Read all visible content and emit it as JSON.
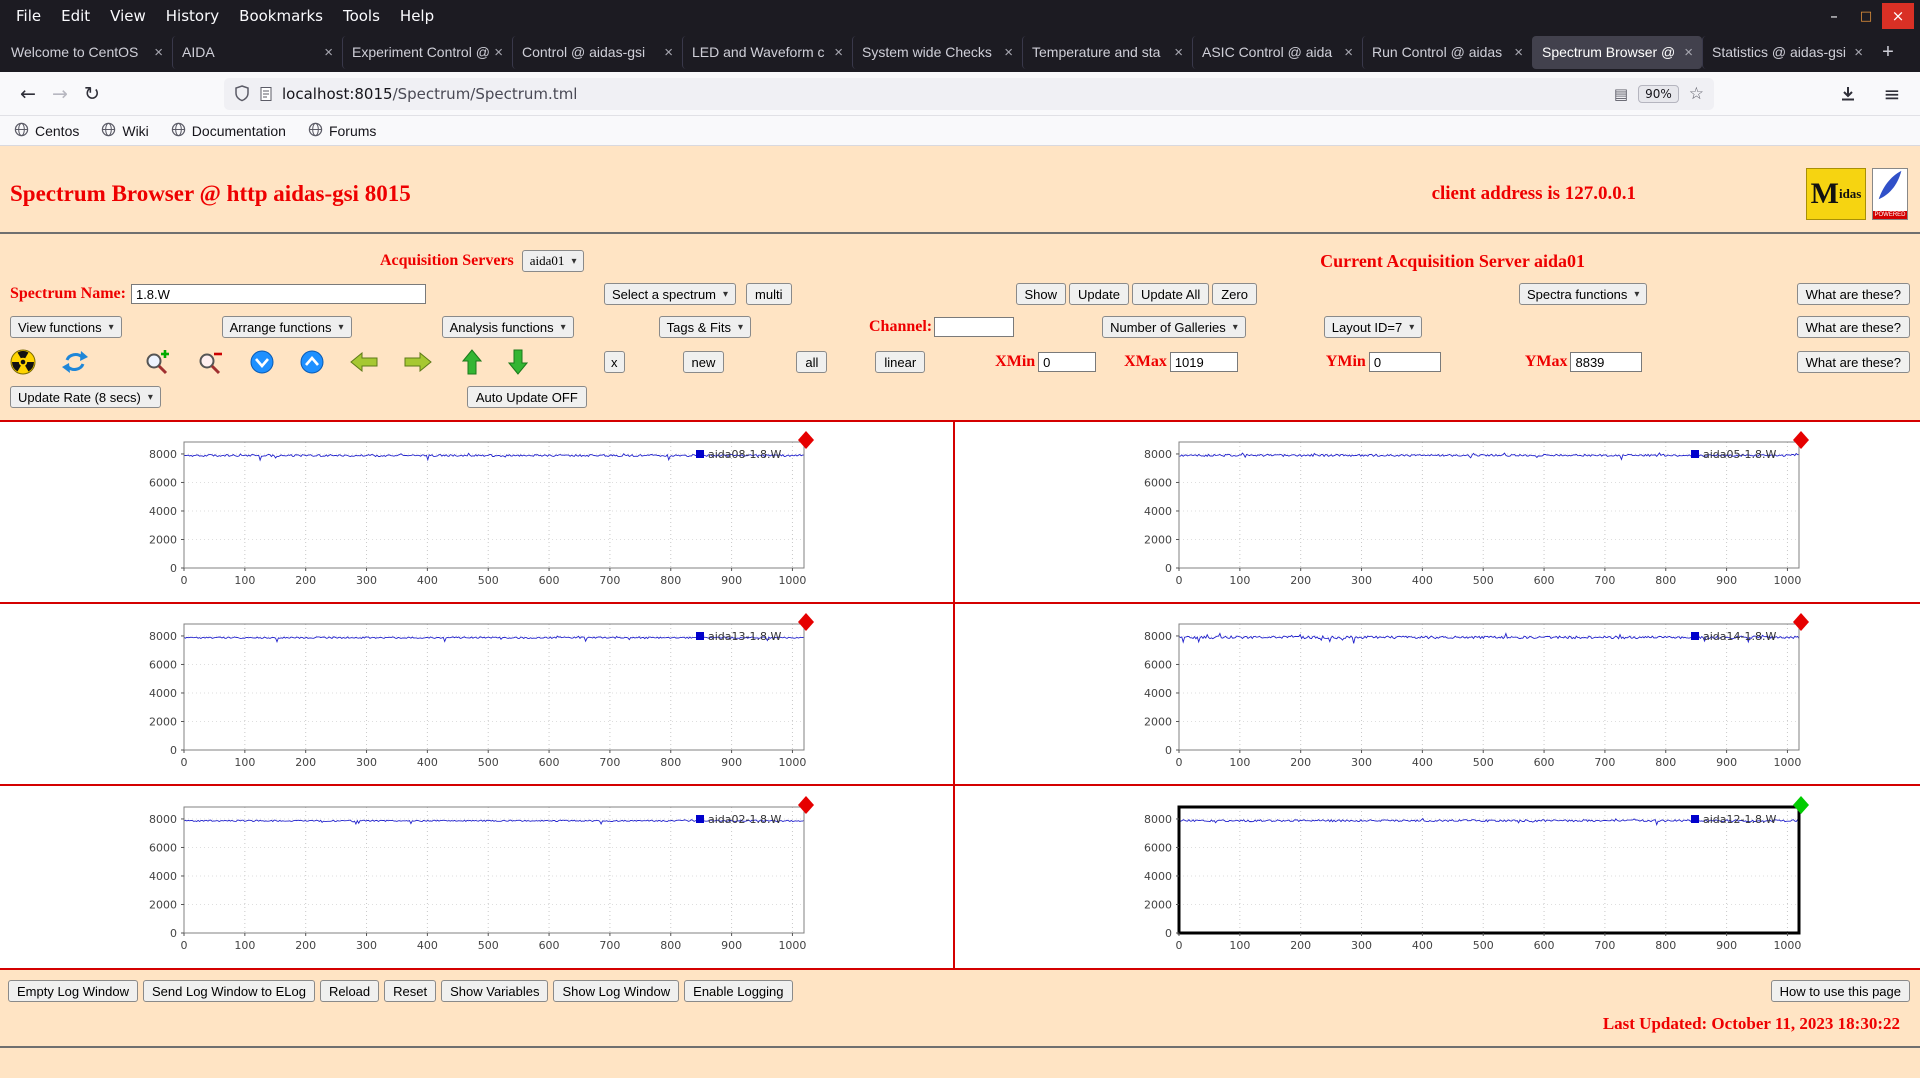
{
  "colors": {
    "accent_red": "#ee0000",
    "page_bg": "#ffe4c4",
    "chart_line": "#2222cc",
    "legend_square": "#0000cc",
    "grid_border_red": "#d40000",
    "marker_red": "#e60000",
    "marker_green": "#00cc00"
  },
  "icons": {
    "chevron_down": "▾",
    "back": "←",
    "forward": "→",
    "reload": "↻",
    "star": "☆",
    "reader": "▤",
    "hamburger": "≡",
    "minimize": "–",
    "maximize": "□",
    "close": "×",
    "tab_close": "×"
  },
  "toolbar_icons": [
    "radiation-icon",
    "refresh-icon",
    "zoom-in-icon",
    "zoom-out-icon",
    "sphere-down-icon",
    "sphere-up-icon",
    "arrow-left-icon",
    "arrow-right-icon",
    "arrow-up-icon",
    "arrow-down-icon"
  ],
  "browser": {
    "menu": [
      "File",
      "Edit",
      "View",
      "History",
      "Bookmarks",
      "Tools",
      "Help"
    ],
    "tabs": [
      {
        "label": "Welcome to CentOS",
        "active": false
      },
      {
        "label": "AIDA",
        "active": false
      },
      {
        "label": "Experiment Control @",
        "active": false
      },
      {
        "label": "Control @ aidas-gsi",
        "active": false
      },
      {
        "label": "LED and Waveform c",
        "active": false
      },
      {
        "label": "System wide Checks",
        "active": false
      },
      {
        "label": "Temperature and sta",
        "active": false
      },
      {
        "label": "ASIC Control @ aida",
        "active": false
      },
      {
        "label": "Run Control @ aidas",
        "active": false
      },
      {
        "label": "Spectrum Browser @",
        "active": true
      },
      {
        "label": "Statistics @ aidas-gsi",
        "active": false
      }
    ],
    "new_tab": "+",
    "nav": {
      "url_host": "localhost:8015",
      "url_path": "/Spectrum/Spectrum.tml",
      "zoom": "90%"
    },
    "bookmarks": [
      "Centos",
      "Wiki",
      "Documentation",
      "Forums"
    ]
  },
  "page": {
    "title": "Spectrum Browser @ http aidas-gsi 8015",
    "client_address": "client address is 127.0.0.1",
    "midas_logo_m": "M",
    "midas_logo_rest": "idas",
    "powered_logo_text": "POWERED",
    "acquisition_servers_label": "Acquisition Servers",
    "acquisition_server_selected": "aida01",
    "current_server_text": "Current Acquisition Server aida01",
    "spectrum_name_label": "Spectrum Name:",
    "spectrum_name_value": "1.8.W",
    "select_spectrum_label": "Select a spectrum",
    "multi_button": "multi",
    "show_button": "Show",
    "update_button": "Update",
    "update_all_button": "Update All",
    "zero_button": "Zero",
    "spectra_functions_label": "Spectra functions",
    "what_are_these": "What are these?",
    "view_functions_label": "View functions",
    "arrange_functions_label": "Arrange functions",
    "analysis_functions_label": "Analysis functions",
    "tags_fits_label": "Tags & Fits",
    "channel_label": "Channel:",
    "channel_value": "",
    "galleries_label": "Number of Galleries",
    "layout_label": "Layout ID=7",
    "x_button": "x",
    "new_button": "new",
    "all_button": "all",
    "linear_button": "linear",
    "xmin_label": "XMin",
    "xmin_value": "0",
    "xmax_label": "XMax",
    "xmax_value": "1019",
    "ymin_label": "YMin",
    "ymin_value": "0",
    "ymax_label": "YMax",
    "ymax_value": "8839",
    "update_rate_label": "Update Rate (8 secs)",
    "auto_update_button": "Auto Update OFF",
    "bottom_buttons": [
      "Empty Log Window",
      "Send Log Window to ELog",
      "Reload",
      "Reset",
      "Show Variables",
      "Show Log Window",
      "Enable Logging"
    ],
    "help_button": "How to use this page",
    "last_updated": "Last Updated: October 11, 2023 18:30:22"
  },
  "chart_data": [
    {
      "type": "line",
      "title": "aida08-1.8.W",
      "xlim": [
        0,
        1019
      ],
      "ylim": [
        0,
        8839
      ],
      "xticks": [
        0,
        100,
        200,
        300,
        400,
        500,
        600,
        700,
        800,
        900,
        1000
      ],
      "yticks": [
        0,
        2000,
        4000,
        6000,
        8000
      ],
      "baseline": 7890,
      "noise": 70,
      "line_color": "#2222cc",
      "marker_color": "#e60000",
      "selected": false
    },
    {
      "type": "line",
      "title": "aida05-1.8.W",
      "xlim": [
        0,
        1019
      ],
      "ylim": [
        0,
        8839
      ],
      "xticks": [
        0,
        100,
        200,
        300,
        400,
        500,
        600,
        700,
        800,
        900,
        1000
      ],
      "yticks": [
        0,
        2000,
        4000,
        6000,
        8000
      ],
      "baseline": 7900,
      "noise": 75,
      "line_color": "#2222cc",
      "marker_color": "#e60000",
      "selected": false
    },
    {
      "type": "line",
      "title": "aida13-1.8.W",
      "xlim": [
        0,
        1019
      ],
      "ylim": [
        0,
        8839
      ],
      "xticks": [
        0,
        100,
        200,
        300,
        400,
        500,
        600,
        700,
        800,
        900,
        1000
      ],
      "yticks": [
        0,
        2000,
        4000,
        6000,
        8000
      ],
      "baseline": 7880,
      "noise": 55,
      "line_color": "#2222cc",
      "marker_color": "#e60000",
      "selected": false
    },
    {
      "type": "line",
      "title": "aida14-1.8.W",
      "xlim": [
        0,
        1019
      ],
      "ylim": [
        0,
        8839
      ],
      "xticks": [
        0,
        100,
        200,
        300,
        400,
        500,
        600,
        700,
        800,
        900,
        1000
      ],
      "yticks": [
        0,
        2000,
        4000,
        6000,
        8000
      ],
      "baseline": 7900,
      "noise": 95,
      "line_color": "#2222cc",
      "marker_color": "#e60000",
      "selected": false
    },
    {
      "type": "line",
      "title": "aida02-1.8.W",
      "xlim": [
        0,
        1019
      ],
      "ylim": [
        0,
        8839
      ],
      "xticks": [
        0,
        100,
        200,
        300,
        400,
        500,
        600,
        700,
        800,
        900,
        1000
      ],
      "yticks": [
        0,
        2000,
        4000,
        6000,
        8000
      ],
      "baseline": 7870,
      "noise": 50,
      "line_color": "#2222cc",
      "marker_color": "#e60000",
      "selected": false
    },
    {
      "type": "line",
      "title": "aida12-1.8.W",
      "xlim": [
        0,
        1019
      ],
      "ylim": [
        0,
        8839
      ],
      "xticks": [
        0,
        100,
        200,
        300,
        400,
        500,
        600,
        700,
        800,
        900,
        1000
      ],
      "yticks": [
        0,
        2000,
        4000,
        6000,
        8000
      ],
      "baseline": 7880,
      "noise": 70,
      "line_color": "#2222cc",
      "marker_color": "#00cc00",
      "selected": true
    }
  ]
}
